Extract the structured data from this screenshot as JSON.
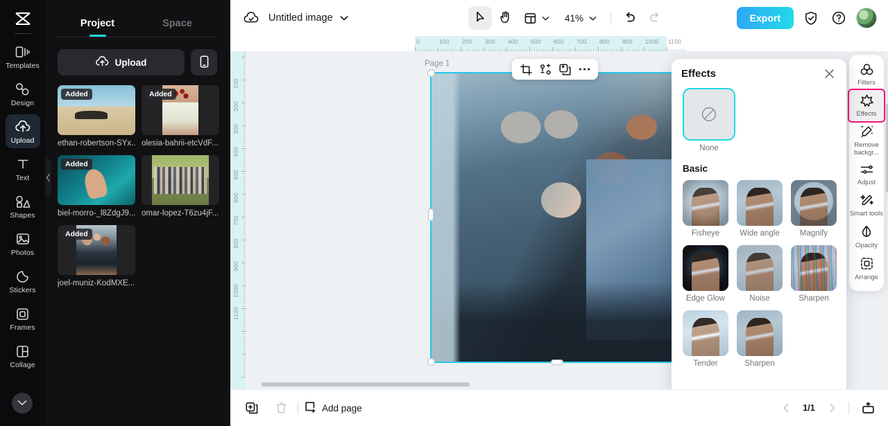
{
  "app": {
    "logo_icon": "capcut-logo-icon"
  },
  "rail": {
    "items": [
      {
        "label": "Templates",
        "icon": "templates-icon",
        "active": false
      },
      {
        "label": "Design",
        "icon": "design-icon",
        "active": false
      },
      {
        "label": "Upload",
        "icon": "upload-cloud-icon",
        "active": true
      },
      {
        "label": "Text",
        "icon": "text-t-icon",
        "active": false
      },
      {
        "label": "Shapes",
        "icon": "shapes-icon",
        "active": false
      },
      {
        "label": "Photos",
        "icon": "photos-icon",
        "active": false
      },
      {
        "label": "Stickers",
        "icon": "sticker-icon",
        "active": false
      },
      {
        "label": "Frames",
        "icon": "frames-icon",
        "active": false
      },
      {
        "label": "Collage",
        "icon": "collage-icon",
        "active": false
      }
    ],
    "collapse_icon": "chevron-down-icon"
  },
  "panel": {
    "tabs": [
      {
        "label": "Project",
        "active": true
      },
      {
        "label": "Space",
        "active": false
      }
    ],
    "upload_label": "Upload",
    "upload_icon": "upload-cloud-icon",
    "device_icon": "mobile-phone-icon",
    "assets": [
      {
        "name": "ethan-robertson-SYx...",
        "badge": "Added",
        "art": "art-beach",
        "full": false
      },
      {
        "name": "olesia-bahrii-etcVdF...",
        "badge": "Added",
        "art": "art-cake",
        "full": false
      },
      {
        "name": "biel-morro-_l8ZdgJ9...",
        "badge": "Added",
        "art": "art-water",
        "full": false
      },
      {
        "name": "omar-lopez-T6zu4jF...",
        "badge": "",
        "art": "art-group",
        "full": false
      },
      {
        "name": "joel-muniz-KodMXE...",
        "badge": "Added",
        "art": "art-stairs",
        "full": false
      }
    ],
    "collapse_handle_icon": "chevron-left-icon"
  },
  "topbar": {
    "cloud_icon": "cloud-saved-icon",
    "doc_title": "Untitled image",
    "title_caret_icon": "chevron-down-icon",
    "tools": [
      {
        "name": "select-tool",
        "icon": "cursor-arrow-icon",
        "selected": true
      },
      {
        "name": "hand-tool",
        "icon": "hand-icon",
        "selected": false
      },
      {
        "name": "layout-tool",
        "icon": "layout-grid-icon",
        "selected": false
      }
    ],
    "layout_caret_icon": "chevron-down-icon",
    "zoom_value": "41%",
    "zoom_caret_icon": "chevron-down-icon",
    "undo_icon": "undo-arrow-icon",
    "redo_icon": "redo-arrow-icon",
    "export_label": "Export",
    "shield_icon": "shield-check-icon",
    "help_icon": "question-circle-icon",
    "avatar_icon": "user-avatar"
  },
  "canvas": {
    "page_label": "Page 1",
    "ruler_h_labels": [
      "0",
      "100",
      "200",
      "300",
      "400",
      "500",
      "600",
      "700",
      "800",
      "900",
      "1000",
      "1100"
    ],
    "ruler_v_labels": [
      "100",
      "200",
      "300",
      "400",
      "500",
      "600",
      "700",
      "800",
      "900",
      "1000",
      "1100"
    ],
    "selection_color": "#22c8e6",
    "object_toolbar": [
      {
        "name": "crop-button",
        "icon": "crop-icon"
      },
      {
        "name": "remove-bg-button",
        "icon": "cutout-nodes-icon"
      },
      {
        "name": "duplicate-button",
        "icon": "duplicate-icon"
      },
      {
        "name": "more-options-button",
        "icon": "ellipsis-icon"
      }
    ]
  },
  "effects": {
    "title": "Effects",
    "close_icon": "close-x-icon",
    "none_label": "None",
    "none_icon": "no-effect-slash-icon",
    "section_label": "Basic",
    "items": [
      {
        "label": "Fisheye",
        "style": "t-fisheye"
      },
      {
        "label": "Wide angle",
        "style": "t-wide"
      },
      {
        "label": "Magnify",
        "style": "t-magnify"
      },
      {
        "label": "Edge Glow",
        "style": "t-edge"
      },
      {
        "label": "Noise",
        "style": "t-noise"
      },
      {
        "label": "Sharpen",
        "style": "t-sharp"
      },
      {
        "label": "Tender",
        "style": "t-tender"
      },
      {
        "label": "Sharpen",
        "style": "t-wide"
      }
    ]
  },
  "dock": {
    "highlight_color": "#f5147a",
    "items": [
      {
        "label": "Filters",
        "icon": "filters-circles-icon",
        "selected": false
      },
      {
        "label": "Effects",
        "icon": "effects-star-icon",
        "selected": true
      },
      {
        "label": "Remove backgr...",
        "icon": "remove-background-icon",
        "selected": false
      },
      {
        "label": "Adjust",
        "icon": "adjust-sliders-icon",
        "selected": false
      },
      {
        "label": "Smart tools",
        "icon": "magic-wand-icon",
        "selected": false
      },
      {
        "label": "Opacity",
        "icon": "opacity-drop-icon",
        "selected": false
      },
      {
        "label": "Arrange",
        "icon": "arrange-box-icon",
        "selected": false
      }
    ]
  },
  "bottombar": {
    "duplicate_page_icon": "duplicate-page-icon",
    "delete_page_icon": "trash-icon",
    "add_page_label": "Add page",
    "add_page_icon": "add-page-icon",
    "prev_icon": "chevron-left-icon",
    "page_indicator": "1/1",
    "next_icon": "chevron-right-icon",
    "present_icon": "present-icon"
  }
}
